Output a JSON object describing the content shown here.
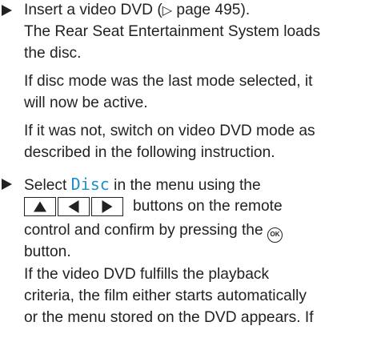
{
  "step1": {
    "prefix": "Insert a video DVD (",
    "ref_arrow": "▷",
    "suffix": " page 495).",
    "para1_line1": "The Rear Seat Entertainment System loads",
    "para1_line2": "the disc.",
    "para2_line1": "If disc mode was the last mode selected, it",
    "para2_line2": "will now be active.",
    "para3_line1": "If it was not, switch on video DVD mode as",
    "para3_line2": "described in the following instruction."
  },
  "step2": {
    "line1_prefix": "Select ",
    "keyword": "Disc",
    "line1_suffix": " in the menu using the",
    "keys": [
      "up-arrow",
      "left-arrow",
      "right-arrow"
    ],
    "line2_suffix": "buttons on the remote",
    "line3_prefix": "control and confirm by pressing the ",
    "ok_label": "OK",
    "line4": "button.",
    "result_line1": "If the video DVD fulfills the playback",
    "result_line2": "criteria, the film either starts automatically",
    "result_line3": "or the menu stored on the DVD appears. If"
  }
}
